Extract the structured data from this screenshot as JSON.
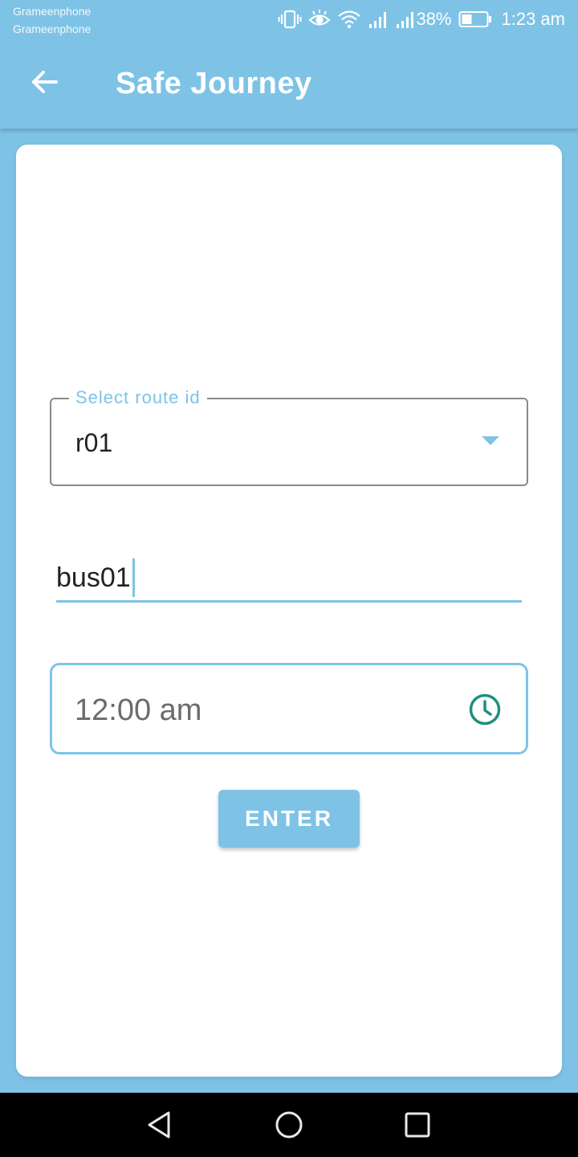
{
  "status_bar": {
    "carrier_1": "Grameenphone",
    "carrier_2": "Grameenphone",
    "battery_percent": "38%",
    "time": "1:23 am",
    "icons": [
      "vibrate-icon",
      "eye-comfort-icon",
      "wifi-icon",
      "signal-icon",
      "signal-icon",
      "battery-icon"
    ]
  },
  "app_bar": {
    "title": "Safe Journey",
    "back_icon": "arrow-back-icon"
  },
  "form": {
    "route": {
      "label": "Select route id",
      "value": "r01"
    },
    "bus": {
      "value": "bus01"
    },
    "time": {
      "value": "12:00 am",
      "icon": "clock-icon"
    },
    "submit_label": "ENTER"
  },
  "colors": {
    "primary": "#7ec3e6",
    "clock_icon": "#1e8f7f"
  },
  "nav_bar": {
    "icons": [
      "nav-back-icon",
      "nav-home-icon",
      "nav-recents-icon"
    ]
  }
}
